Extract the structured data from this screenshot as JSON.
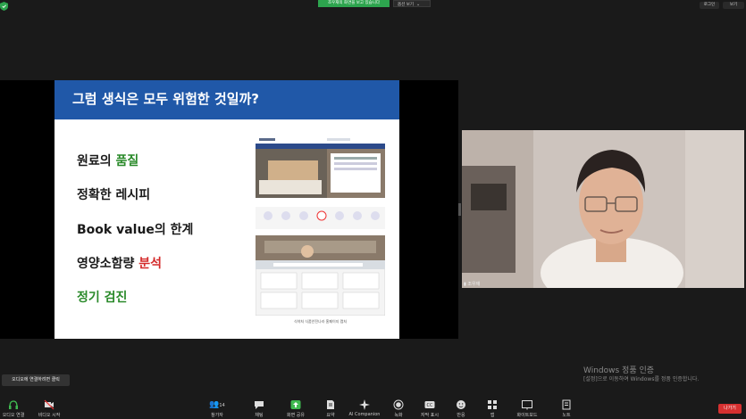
{
  "top_bar": {
    "share_banner": "조우재의 화면을 보고 있습니다",
    "view_options": "옵션 보기",
    "recording": "로그인",
    "view_button": "보기"
  },
  "slide": {
    "title": "그럼 생식은 모두 위험한 것일까?",
    "bullets": {
      "b1_text": "원료의 ",
      "b1_highlight": "품질",
      "b2_text": "정확한 레시피",
      "b3_text": "Book value의 한계",
      "b4_text": "영양소함량 ",
      "b4_highlight": "분석",
      "b5_text": "정기 검진"
    },
    "caption": "식약처 식품안전나라 홈페이지 캡처"
  },
  "participant": {
    "name": "조우재"
  },
  "watermark": {
    "title": "Windows 정품 인증",
    "subtitle": "[설정]으로 이동하여 Windows를 정품 인증합니다."
  },
  "tooltip": "오디오에 연결하려면 클릭",
  "toolbar": {
    "audio": "오디오 연결",
    "video": "비디오 시작",
    "participants": "참가자",
    "participants_count": "14",
    "chat": "채팅",
    "share": "화면 공유",
    "summary": "요약",
    "ai_companion": "AI Companion",
    "record": "녹화",
    "captions": "자막 표시",
    "reactions": "반응",
    "apps": "앱",
    "whiteboard": "화이트보드",
    "notes": "노트",
    "end": "나가기"
  },
  "colors": {
    "background": "#1a1a1a",
    "share_green": "#2da44e",
    "slide_title_blue": "#2058a8",
    "highlight_green": "#2a8a2a",
    "highlight_red": "#d42a2a",
    "end_red": "#d63030"
  }
}
